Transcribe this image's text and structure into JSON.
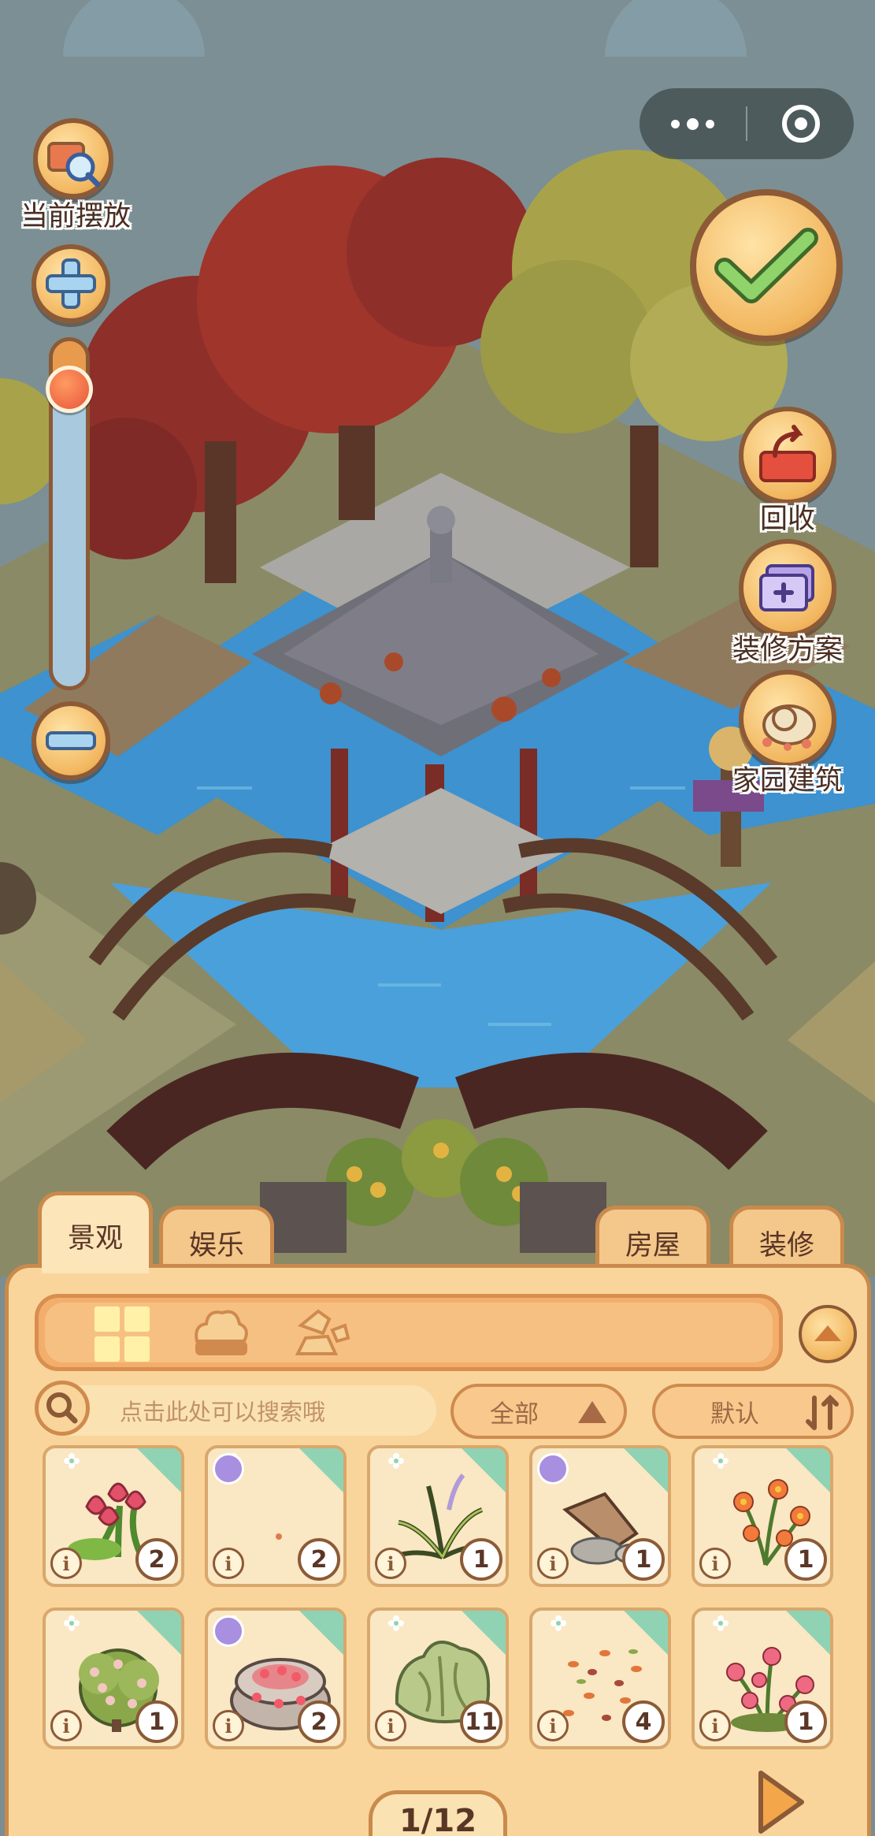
{
  "capsule": {
    "more_icon": "more-dots-icon",
    "close_icon": "target-close-icon"
  },
  "left_tools": {
    "current_placed_label": "当前摆放",
    "zoom_level": 0.08
  },
  "right_tools": {
    "confirm_icon": "checkmark-icon",
    "recycle_label": "回收",
    "plan_label": "装修方案",
    "building_label": "家园建筑"
  },
  "tabs": [
    {
      "label": "景观",
      "active": true
    },
    {
      "label": "娱乐",
      "active": false
    },
    {
      "label": "房屋",
      "active": false
    },
    {
      "label": "装修",
      "active": false
    }
  ],
  "categories": [
    {
      "icon": "grid-icon",
      "selected": true
    },
    {
      "icon": "shrub-icon",
      "selected": false
    },
    {
      "icon": "rock-icon",
      "selected": false
    }
  ],
  "search": {
    "placeholder": "点击此处可以搜索哦"
  },
  "filter": {
    "label": "全部"
  },
  "sort": {
    "label": "默认"
  },
  "items": [
    {
      "name": "red-tulips",
      "count": "2",
      "tag": false
    },
    {
      "name": "tiny-item",
      "count": "2",
      "tag": true
    },
    {
      "name": "wild-grass",
      "count": "1",
      "tag": false
    },
    {
      "name": "driftwood-rocks",
      "count": "1",
      "tag": true
    },
    {
      "name": "orange-wildflowers",
      "count": "1",
      "tag": false
    },
    {
      "name": "flowering-shrub",
      "count": "1",
      "tag": false
    },
    {
      "name": "flower-planter",
      "count": "2",
      "tag": true
    },
    {
      "name": "green-bush",
      "count": "11",
      "tag": false
    },
    {
      "name": "fallen-petals",
      "count": "4",
      "tag": false
    },
    {
      "name": "pink-wildflowers",
      "count": "1",
      "tag": false
    }
  ],
  "pagination": {
    "label": "1/12"
  },
  "colors": {
    "panel": "#f9d59c",
    "accent_green": "#8fd3b4",
    "brown_outline": "#8c5a36"
  }
}
